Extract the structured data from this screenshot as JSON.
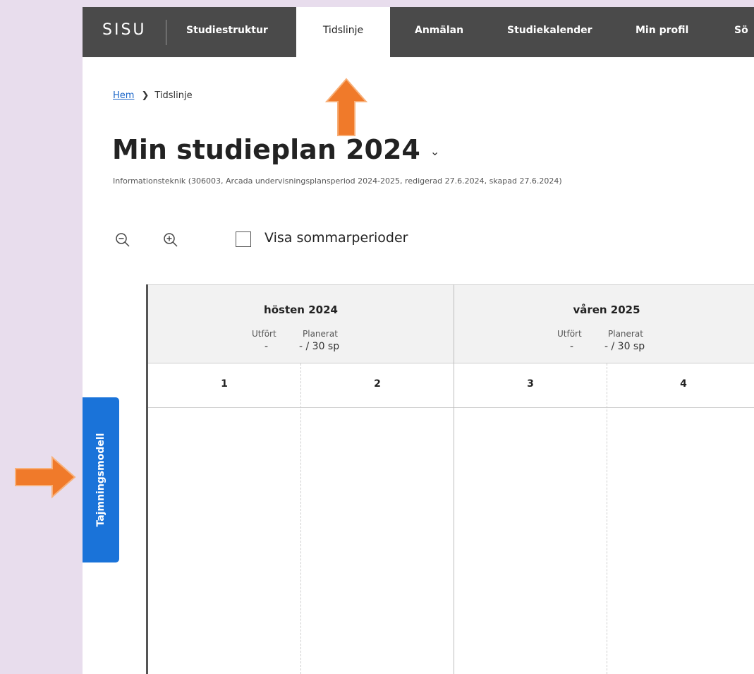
{
  "nav": {
    "logo": "SISU",
    "items": [
      {
        "label": "Studiestruktur",
        "active": false
      },
      {
        "label": "Tidslinje",
        "active": true
      },
      {
        "label": "Anmälan",
        "active": false
      },
      {
        "label": "Studiekalender",
        "active": false
      },
      {
        "label": "Min profil",
        "active": false
      },
      {
        "label": "Sö",
        "active": false
      }
    ]
  },
  "breadcrumb": {
    "home": "Hem",
    "current": "Tidslinje"
  },
  "plan": {
    "title": "Min studieplan 2024",
    "subtitle": "Informationsteknik (306003, Arcada undervisningsplansperiod 2024-2025, redigerad 27.6.2024, skapad 27.6.2024)"
  },
  "controls": {
    "zoom_out_icon": "zoom-out-icon",
    "zoom_in_icon": "zoom-in-icon",
    "summer_checkbox_label": "Visa sommarperioder",
    "summer_checked": false
  },
  "timeline": {
    "terms": [
      {
        "name": "hösten 2024",
        "done_label": "Utfört",
        "planned_label": "Planerat",
        "done_value": "-",
        "planned_value": "- / 30 sp"
      },
      {
        "name": "våren 2025",
        "done_label": "Utfört",
        "planned_label": "Planerat",
        "done_value": "-",
        "planned_value": "- / 30 sp"
      }
    ],
    "periods": [
      "1",
      "2",
      "3",
      "4"
    ]
  },
  "side_tab": {
    "label": "Tajmningsmodell"
  },
  "colors": {
    "nav_bg": "#4a4a4a",
    "accent_blue": "#1a73d9",
    "annotation_orange": "#f07a2a",
    "frame_bg": "#e8dded"
  }
}
